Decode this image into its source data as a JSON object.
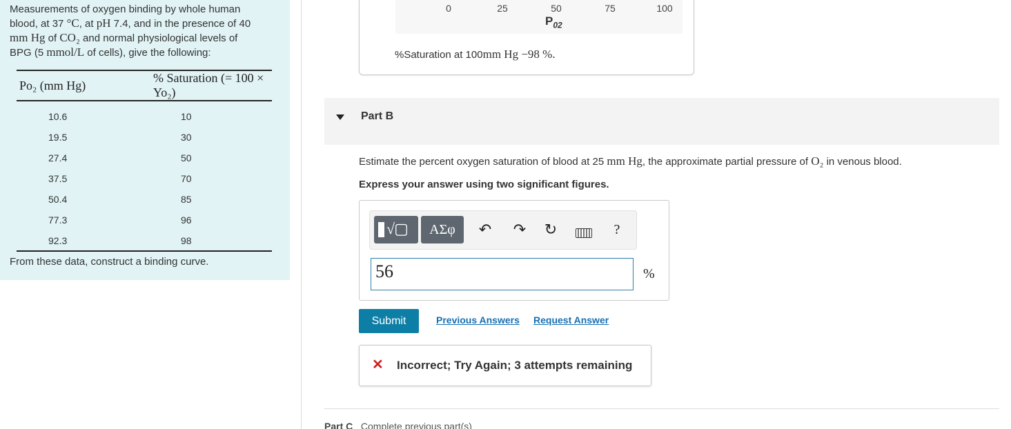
{
  "problem": {
    "intro_1": "Measurements of oxygen binding by whole human",
    "intro_2a": "blood, at 37 ",
    "intro_2_degC": "°C",
    "intro_2b": ", at ",
    "intro_2_pH": "pH",
    "intro_2c": " 7.4, and in the presence of 40",
    "intro_3_mmhg": "mm Hg",
    "intro_3a": " of ",
    "intro_3_co2": "CO₂",
    "intro_3b": " and normal physiological levels of",
    "intro_4a": "BPG (5 ",
    "intro_4_unit": "mmol/L",
    "intro_4b": " of cells), give the following:",
    "table": {
      "header_1": "Po₂ (mm Hg)",
      "header_2": "% Saturation (= 100 × Yo₂)",
      "rows": [
        [
          "10.6",
          "10"
        ],
        [
          "19.5",
          "30"
        ],
        [
          "27.4",
          "50"
        ],
        [
          "37.5",
          "70"
        ],
        [
          "50.4",
          "85"
        ],
        [
          "77.3",
          "96"
        ],
        [
          "92.3",
          "98"
        ]
      ]
    },
    "construct": "From these data, construct a binding curve."
  },
  "part_a": {
    "ticks": [
      "0",
      "25",
      "50",
      "75",
      "100"
    ],
    "axis_label": "P",
    "axis_label_sub": "02",
    "saturation_a": "%Saturation at 100",
    "saturation_b": "mm Hg",
    "saturation_c": " −98 %."
  },
  "part_b": {
    "title": "Part B",
    "question_a": "Estimate the percent oxygen saturation of blood at 25 ",
    "question_unit": "mm Hg",
    "question_b": ", the approximate partial pressure of ",
    "question_o2": "O₂",
    "question_c": " in venous blood.",
    "instruction": "Express your answer using two significant figures.",
    "toolbar": {
      "math_symbol": "√▢",
      "greek": "ΑΣφ",
      "help": "?"
    },
    "answer_value": "56",
    "unit": "%",
    "submit": "Submit",
    "previous_answers": "Previous Answers",
    "request_answer": "Request Answer",
    "feedback": "Incorrect; Try Again; 3 attempts remaining"
  },
  "part_c": {
    "label": "Part C",
    "status": "Complete previous part(s)"
  }
}
